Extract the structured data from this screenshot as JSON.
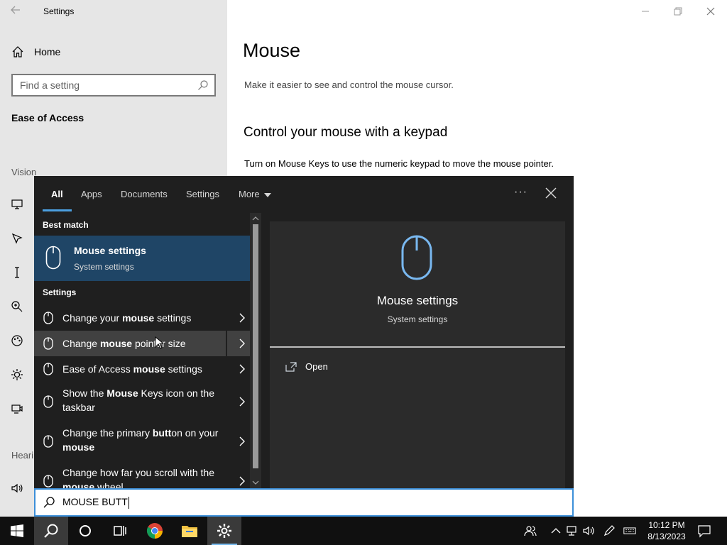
{
  "window": {
    "title": "Settings"
  },
  "sidebar": {
    "home_label": "Home",
    "search_placeholder": "Find a setting",
    "section_title": "Ease of Access",
    "vision_label": "Vision",
    "hearing_label": "Heari",
    "icons": [
      "display-icon",
      "mouse-pointer-icon",
      "text-cursor-icon",
      "magnifier-icon",
      "color-filter-icon",
      "high-contrast-icon",
      "narrator-icon",
      "audio-icon"
    ]
  },
  "main": {
    "title": "Mouse",
    "description": "Make it easier to see and control the mouse cursor.",
    "section_title": "Control your mouse with a keypad",
    "section_desc": "Turn on Mouse Keys to use the numeric keypad to move the mouse pointer."
  },
  "search_flyout": {
    "tabs": [
      {
        "label": "All"
      },
      {
        "label": "Apps"
      },
      {
        "label": "Documents"
      },
      {
        "label": "Settings"
      },
      {
        "label": "More"
      }
    ],
    "more_options": "···",
    "best_match_label": "Best match",
    "best_match": {
      "title": "Mouse settings",
      "subtitle": "System settings"
    },
    "settings_label": "Settings",
    "results": [
      {
        "parts": [
          "Change your ",
          "mouse",
          " settings"
        ]
      },
      {
        "parts": [
          "Change ",
          "mouse",
          " pointer size"
        ]
      },
      {
        "parts": [
          "Ease of Access ",
          "mouse",
          " settings"
        ]
      },
      {
        "parts": [
          "Show the ",
          "Mouse",
          " Keys icon on the taskbar"
        ]
      },
      {
        "parts": [
          "Change the primary ",
          "butt",
          "on on your ",
          "mouse"
        ]
      },
      {
        "parts": [
          "Change how far you scroll with the ",
          "mouse",
          " wheel"
        ]
      }
    ],
    "preview": {
      "title": "Mouse settings",
      "subtitle": "System settings",
      "open_label": "Open"
    },
    "query": "MOUSE BUTT"
  },
  "taskbar": {
    "time": "10:12 PM",
    "date": "8/13/2023"
  },
  "colors": {
    "accent": "#4c9fe0",
    "best_match_bg": "#1f4566",
    "flyout_bg": "#1f1f1f"
  }
}
